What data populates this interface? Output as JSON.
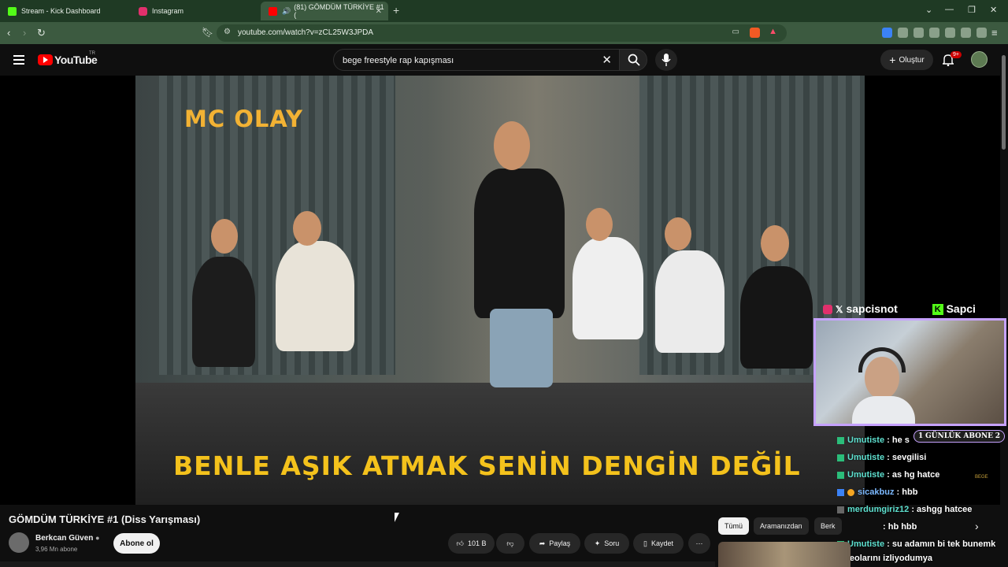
{
  "browser": {
    "tabs": [
      {
        "label": "Stream - Kick Dashboard",
        "favicon": "kick-icon",
        "color": "#53fc18"
      },
      {
        "label": "Instagram",
        "favicon": "instagram-icon",
        "color": "#e1306c"
      },
      {
        "label": "(81) GÖMDÜM TÜRKİYE #1 (",
        "favicon": "youtube-icon",
        "color": "#ff0000",
        "active": true
      }
    ],
    "url": "youtube.com/watch?v=zCL25W3JPDA"
  },
  "youtube": {
    "logo_text": "YouTube",
    "region": "TR",
    "search_query": "bege freestyle rap kapışması",
    "create_label": "Oluştur",
    "notifications": "9+"
  },
  "video": {
    "corner_text": "MC OLAY",
    "caption": "BENLE AŞIK ATMAK SENİN DENGİN DEĞİL",
    "title": "GÖMDÜM TÜRKİYE #1 (Diss Yarışması)",
    "channel": "Berkcan Güven",
    "subscribers": "3,96 Mn abone",
    "subscribe_label": "Abone ol",
    "likes": "101 B",
    "share_label": "Paylaş",
    "ask_label": "Soru",
    "save_label": "Kaydet"
  },
  "stream_overlay": {
    "instagram_handle": "sapcisnot",
    "kick_handle": "Sapci",
    "sub_goal_label": "GÜNLÜK ABONE",
    "sub_goal_left": "1",
    "sub_goal_right": "2",
    "side_label": "BEGE",
    "chat": [
      {
        "user": "Umutiste",
        "text": ": he s"
      },
      {
        "user": "Umutiste",
        "text": ": sevgilisi"
      },
      {
        "user": "Umutiste",
        "text": ": as hg hatce"
      },
      {
        "user": "sicakbuz",
        "text": ": hbb"
      },
      {
        "user": "merdumgiriz12",
        "text": ": ashgg hatcee"
      },
      {
        "user": "",
        "text": ": hb hbb"
      },
      {
        "user": "Umutiste",
        "text": ": su adamın bi tek bunemk"
      },
      {
        "user": "",
        "text": "videolarını izliyodumya"
      }
    ]
  },
  "filters": [
    "Tümü",
    "Aramanızdan",
    "Berk"
  ]
}
